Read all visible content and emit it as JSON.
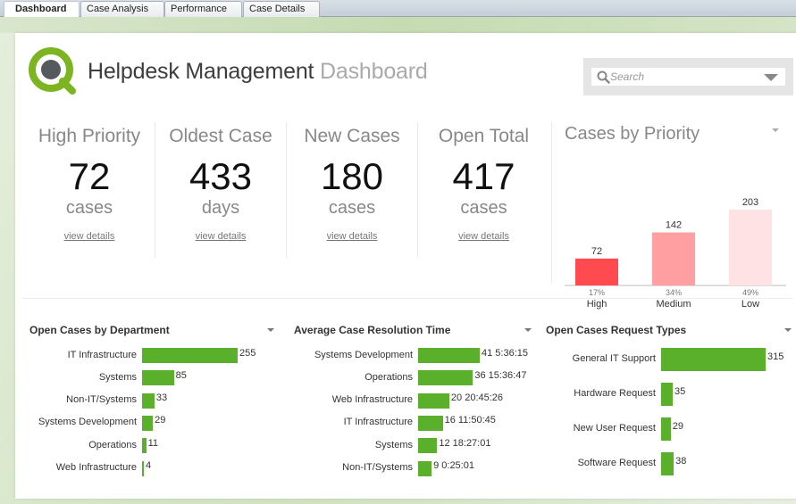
{
  "tabs": [
    {
      "label": "Dashboard",
      "active": true
    },
    {
      "label": "Case Analysis",
      "active": false
    },
    {
      "label": "Performance",
      "active": false
    },
    {
      "label": "Case Details",
      "active": false
    }
  ],
  "header": {
    "title_main": "Helpdesk Management",
    "title_sub": "Dashboard",
    "logo_icon": "qlik-q-logo"
  },
  "search": {
    "placeholder": "Search",
    "value": "",
    "icon": "search-icon"
  },
  "kpis": [
    {
      "title": "High Priority",
      "value": "72",
      "unit": "cases",
      "link": "view details"
    },
    {
      "title": "Oldest Case",
      "value": "433",
      "unit": "days",
      "link": "view details"
    },
    {
      "title": "New Cases",
      "value": "180",
      "unit": "cases",
      "link": "view details"
    },
    {
      "title": "Open Total",
      "value": "417",
      "unit": "cases",
      "link": "view details"
    }
  ],
  "colors": {
    "accent_green": "#5aaf2b",
    "logo_green": "#7cb521",
    "high": "#ff4b4f",
    "medium": "#ff9fa1",
    "low": "#ffe3e4"
  },
  "chart_data": [
    {
      "type": "bar",
      "title": "Cases by Priority",
      "categories": [
        "High",
        "Medium",
        "Low"
      ],
      "values": [
        72,
        142,
        203
      ],
      "percent_labels": [
        "17%",
        "34%",
        "49%"
      ],
      "colors": [
        "#ff4b4f",
        "#ff9fa1",
        "#ffe3e4"
      ],
      "xlabel": "",
      "ylabel": "",
      "ylim": [
        0,
        203
      ],
      "grid": false
    },
    {
      "type": "bar",
      "orientation": "horizontal",
      "title": "Open Cases by Department",
      "categories": [
        "IT Infrastructure",
        "Systems",
        "Non-IT/Systems",
        "Systems Development",
        "Operations",
        "Web Infrastructure"
      ],
      "values": [
        255,
        85,
        33,
        29,
        11,
        4
      ],
      "value_labels": [
        "255",
        "85",
        "33",
        "29",
        "11",
        "4"
      ],
      "xlim": [
        0,
        255
      ]
    },
    {
      "type": "bar",
      "orientation": "horizontal",
      "title": "Average Case Resolution Time",
      "categories": [
        "Systems Development",
        "Operations",
        "Web Infrastructure",
        "IT Infrastructure",
        "Systems",
        "Non-IT/Systems"
      ],
      "values": [
        41.23,
        36.65,
        20.87,
        16.49,
        12.77,
        9.02
      ],
      "value_labels": [
        "41 5:36:15",
        "36 15:36:47",
        "20 20:45:26",
        "16 11:50:45",
        "12 18:27:01",
        "9 0:25:01"
      ],
      "unit": "days",
      "xlim": [
        0,
        41.23
      ]
    },
    {
      "type": "bar",
      "orientation": "horizontal",
      "title": "Open Cases Request Types",
      "categories": [
        "General IT Support",
        "Hardware Request",
        "New User Request",
        "Software Request"
      ],
      "values": [
        315,
        35,
        29,
        38
      ],
      "value_labels": [
        "315",
        "35",
        "29",
        "38"
      ],
      "xlim": [
        0,
        315
      ]
    }
  ]
}
